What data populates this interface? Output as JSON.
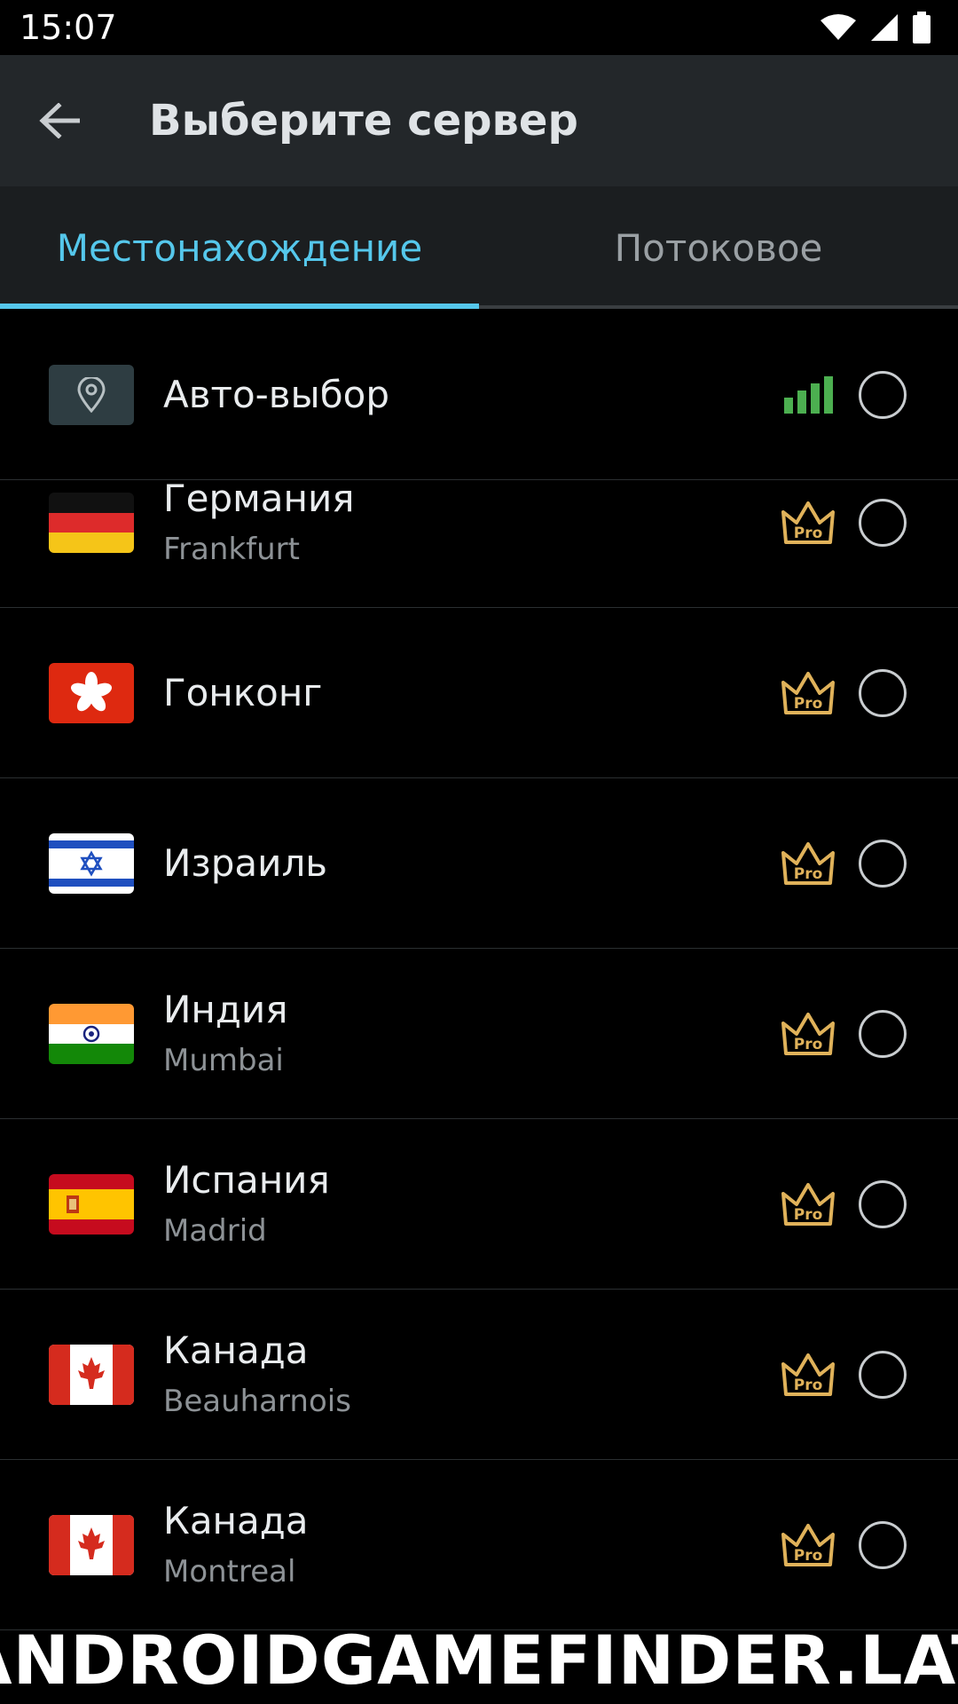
{
  "status_bar": {
    "time": "15:07"
  },
  "app_bar": {
    "title": "Выберите сервер"
  },
  "tabs": [
    {
      "label": "Местонахождение",
      "active": true
    },
    {
      "label": "Потоковое",
      "active": false
    }
  ],
  "auto_select": {
    "label": "Авто-выбор"
  },
  "servers": [
    {
      "country": "Германия",
      "city": "Frankfurt",
      "flag": "germany-flag"
    },
    {
      "country": "Гонконг",
      "city": "",
      "flag": "hong-kong-flag"
    },
    {
      "country": "Израиль",
      "city": "",
      "flag": "israel-flag"
    },
    {
      "country": "Индия",
      "city": "Mumbai",
      "flag": "india-flag"
    },
    {
      "country": "Испания",
      "city": "Madrid",
      "flag": "spain-flag"
    },
    {
      "country": "Канада",
      "city": "Beauharnois",
      "flag": "canada-flag"
    },
    {
      "country": "Канада",
      "city": "Montreal",
      "flag": "canada-flag"
    }
  ],
  "pro_badge": {
    "label": "Pro"
  },
  "watermark": "ANDROIDGAMEFINDER.LAT",
  "colors": {
    "accent": "#55c7eb",
    "pro": "#e0b25a",
    "signal": "#4caf50",
    "app_bar": "#23272a"
  }
}
